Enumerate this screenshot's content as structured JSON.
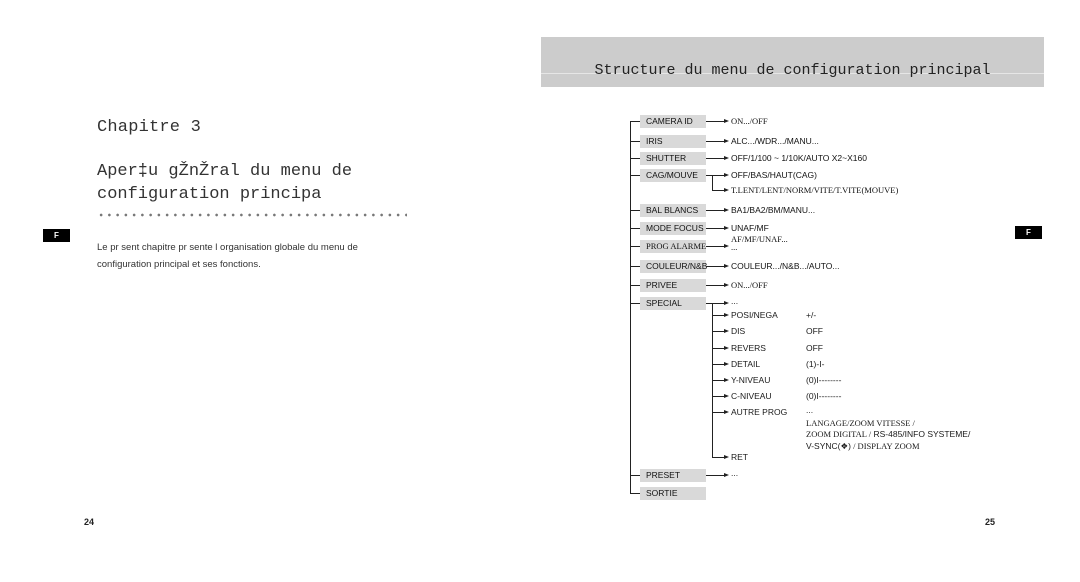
{
  "left_page": {
    "chapter_title": "Chapitre 3",
    "subtitle_line1": "Aper‡u gŽnŽral du menu de",
    "subtitle_line2": "configuration principa",
    "intro_line1": "Le pr sent chapitre pr sente l organisation globale du menu de",
    "intro_line2": "configuration principal et ses fonctions.",
    "language_tab": "F",
    "page_number": "24"
  },
  "right_page": {
    "header_title": "Structure du menu de configuration principal",
    "language_tab": "F",
    "page_number": "25",
    "menu": [
      {
        "label": "CAMERA ID",
        "value": "ON.../OFF",
        "value_serif": true
      },
      {
        "label": "IRIS",
        "value": "ALC.../WDR.../MANU..."
      },
      {
        "label": "SHUTTER",
        "value": "OFF/1/100 ~ 1/10K/AUTO X2~X160"
      },
      {
        "label": "CAG/MOUVE",
        "value": "OFF/BAS/HAUT(CAG)",
        "value2": "T.LENT/LENT/NORM/VITE/T.VITE(MOUVE)"
      },
      {
        "label": "BAL BLANCS",
        "value": "BA1/BA2/BM/MANU..."
      },
      {
        "label": "MODE FOCUS",
        "value": "UNAF/MF"
      },
      {
        "label": "PROG ALARME",
        "value": "AF/MF/UNAF...",
        "value2": "..."
      },
      {
        "label": "COULEUR/N&B",
        "value": "COULEUR.../N&B.../AUTO..."
      },
      {
        "label": "PRIVEE",
        "value": "ON.../OFF"
      },
      {
        "label": "SPECIAL",
        "value": "..."
      },
      {
        "label": "PRESET",
        "value": "..."
      },
      {
        "label": "SORTIE"
      }
    ],
    "special_submenu": [
      {
        "label": "POSI/NEGA",
        "value": "+/-"
      },
      {
        "label": "DIS",
        "value": "OFF"
      },
      {
        "label": "REVERS",
        "value": "OFF"
      },
      {
        "label": "DETAIL",
        "value": "(1)-I-"
      },
      {
        "label": "Y-NIVEAU",
        "value": "(0)I--------"
      },
      {
        "label": "C-NIVEAU",
        "value": "(0)I--------"
      },
      {
        "label": "AUTRE PROG",
        "value": "..."
      },
      {
        "label": "RET"
      }
    ],
    "autre_prog_details": {
      "line1": "LANGAGE/ZOOM VITESSE /",
      "line2a": "ZOOM DIGITAL /",
      "line2b": " RS-485/INFO SYSTEME/",
      "line3a": "V-SYNC(❖)",
      "line3b": " / DISPLAY ZOOM"
    }
  }
}
